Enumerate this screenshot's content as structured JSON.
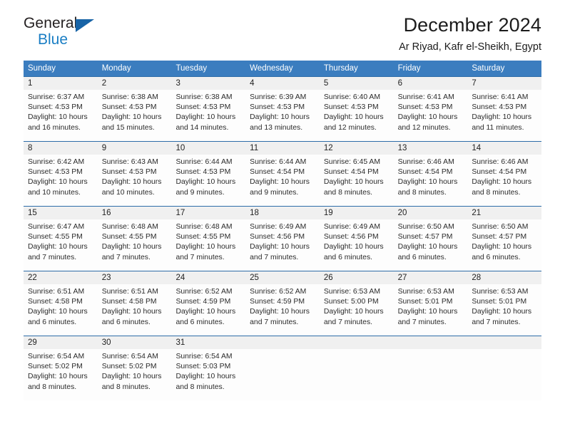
{
  "brand": {
    "name_part1": "General",
    "name_part2": "Blue"
  },
  "header": {
    "title": "December 2024",
    "subtitle": "Ar Riyad, Kafr el-Sheikh, Egypt"
  },
  "colors": {
    "header_blue": "#3b7dbf",
    "row_divider_blue": "#2e6da8",
    "date_band_gray": "#f0f0f0",
    "brand_blue": "#1a7ec4",
    "triangle_blue": "#1763a6",
    "text": "#222222"
  },
  "calendar": {
    "weekday_headers": [
      "Sunday",
      "Monday",
      "Tuesday",
      "Wednesday",
      "Thursday",
      "Friday",
      "Saturday"
    ],
    "weeks": [
      [
        {
          "day": "1",
          "sunrise": "Sunrise: 6:37 AM",
          "sunset": "Sunset: 4:53 PM",
          "daylight_line1": "Daylight: 10 hours",
          "daylight_line2": "and 16 minutes."
        },
        {
          "day": "2",
          "sunrise": "Sunrise: 6:38 AM",
          "sunset": "Sunset: 4:53 PM",
          "daylight_line1": "Daylight: 10 hours",
          "daylight_line2": "and 15 minutes."
        },
        {
          "day": "3",
          "sunrise": "Sunrise: 6:38 AM",
          "sunset": "Sunset: 4:53 PM",
          "daylight_line1": "Daylight: 10 hours",
          "daylight_line2": "and 14 minutes."
        },
        {
          "day": "4",
          "sunrise": "Sunrise: 6:39 AM",
          "sunset": "Sunset: 4:53 PM",
          "daylight_line1": "Daylight: 10 hours",
          "daylight_line2": "and 13 minutes."
        },
        {
          "day": "5",
          "sunrise": "Sunrise: 6:40 AM",
          "sunset": "Sunset: 4:53 PM",
          "daylight_line1": "Daylight: 10 hours",
          "daylight_line2": "and 12 minutes."
        },
        {
          "day": "6",
          "sunrise": "Sunrise: 6:41 AM",
          "sunset": "Sunset: 4:53 PM",
          "daylight_line1": "Daylight: 10 hours",
          "daylight_line2": "and 12 minutes."
        },
        {
          "day": "7",
          "sunrise": "Sunrise: 6:41 AM",
          "sunset": "Sunset: 4:53 PM",
          "daylight_line1": "Daylight: 10 hours",
          "daylight_line2": "and 11 minutes."
        }
      ],
      [
        {
          "day": "8",
          "sunrise": "Sunrise: 6:42 AM",
          "sunset": "Sunset: 4:53 PM",
          "daylight_line1": "Daylight: 10 hours",
          "daylight_line2": "and 10 minutes."
        },
        {
          "day": "9",
          "sunrise": "Sunrise: 6:43 AM",
          "sunset": "Sunset: 4:53 PM",
          "daylight_line1": "Daylight: 10 hours",
          "daylight_line2": "and 10 minutes."
        },
        {
          "day": "10",
          "sunrise": "Sunrise: 6:44 AM",
          "sunset": "Sunset: 4:53 PM",
          "daylight_line1": "Daylight: 10 hours",
          "daylight_line2": "and 9 minutes."
        },
        {
          "day": "11",
          "sunrise": "Sunrise: 6:44 AM",
          "sunset": "Sunset: 4:54 PM",
          "daylight_line1": "Daylight: 10 hours",
          "daylight_line2": "and 9 minutes."
        },
        {
          "day": "12",
          "sunrise": "Sunrise: 6:45 AM",
          "sunset": "Sunset: 4:54 PM",
          "daylight_line1": "Daylight: 10 hours",
          "daylight_line2": "and 8 minutes."
        },
        {
          "day": "13",
          "sunrise": "Sunrise: 6:46 AM",
          "sunset": "Sunset: 4:54 PM",
          "daylight_line1": "Daylight: 10 hours",
          "daylight_line2": "and 8 minutes."
        },
        {
          "day": "14",
          "sunrise": "Sunrise: 6:46 AM",
          "sunset": "Sunset: 4:54 PM",
          "daylight_line1": "Daylight: 10 hours",
          "daylight_line2": "and 8 minutes."
        }
      ],
      [
        {
          "day": "15",
          "sunrise": "Sunrise: 6:47 AM",
          "sunset": "Sunset: 4:55 PM",
          "daylight_line1": "Daylight: 10 hours",
          "daylight_line2": "and 7 minutes."
        },
        {
          "day": "16",
          "sunrise": "Sunrise: 6:48 AM",
          "sunset": "Sunset: 4:55 PM",
          "daylight_line1": "Daylight: 10 hours",
          "daylight_line2": "and 7 minutes."
        },
        {
          "day": "17",
          "sunrise": "Sunrise: 6:48 AM",
          "sunset": "Sunset: 4:55 PM",
          "daylight_line1": "Daylight: 10 hours",
          "daylight_line2": "and 7 minutes."
        },
        {
          "day": "18",
          "sunrise": "Sunrise: 6:49 AM",
          "sunset": "Sunset: 4:56 PM",
          "daylight_line1": "Daylight: 10 hours",
          "daylight_line2": "and 7 minutes."
        },
        {
          "day": "19",
          "sunrise": "Sunrise: 6:49 AM",
          "sunset": "Sunset: 4:56 PM",
          "daylight_line1": "Daylight: 10 hours",
          "daylight_line2": "and 6 minutes."
        },
        {
          "day": "20",
          "sunrise": "Sunrise: 6:50 AM",
          "sunset": "Sunset: 4:57 PM",
          "daylight_line1": "Daylight: 10 hours",
          "daylight_line2": "and 6 minutes."
        },
        {
          "day": "21",
          "sunrise": "Sunrise: 6:50 AM",
          "sunset": "Sunset: 4:57 PM",
          "daylight_line1": "Daylight: 10 hours",
          "daylight_line2": "and 6 minutes."
        }
      ],
      [
        {
          "day": "22",
          "sunrise": "Sunrise: 6:51 AM",
          "sunset": "Sunset: 4:58 PM",
          "daylight_line1": "Daylight: 10 hours",
          "daylight_line2": "and 6 minutes."
        },
        {
          "day": "23",
          "sunrise": "Sunrise: 6:51 AM",
          "sunset": "Sunset: 4:58 PM",
          "daylight_line1": "Daylight: 10 hours",
          "daylight_line2": "and 6 minutes."
        },
        {
          "day": "24",
          "sunrise": "Sunrise: 6:52 AM",
          "sunset": "Sunset: 4:59 PM",
          "daylight_line1": "Daylight: 10 hours",
          "daylight_line2": "and 6 minutes."
        },
        {
          "day": "25",
          "sunrise": "Sunrise: 6:52 AM",
          "sunset": "Sunset: 4:59 PM",
          "daylight_line1": "Daylight: 10 hours",
          "daylight_line2": "and 7 minutes."
        },
        {
          "day": "26",
          "sunrise": "Sunrise: 6:53 AM",
          "sunset": "Sunset: 5:00 PM",
          "daylight_line1": "Daylight: 10 hours",
          "daylight_line2": "and 7 minutes."
        },
        {
          "day": "27",
          "sunrise": "Sunrise: 6:53 AM",
          "sunset": "Sunset: 5:01 PM",
          "daylight_line1": "Daylight: 10 hours",
          "daylight_line2": "and 7 minutes."
        },
        {
          "day": "28",
          "sunrise": "Sunrise: 6:53 AM",
          "sunset": "Sunset: 5:01 PM",
          "daylight_line1": "Daylight: 10 hours",
          "daylight_line2": "and 7 minutes."
        }
      ],
      [
        {
          "day": "29",
          "sunrise": "Sunrise: 6:54 AM",
          "sunset": "Sunset: 5:02 PM",
          "daylight_line1": "Daylight: 10 hours",
          "daylight_line2": "and 8 minutes."
        },
        {
          "day": "30",
          "sunrise": "Sunrise: 6:54 AM",
          "sunset": "Sunset: 5:02 PM",
          "daylight_line1": "Daylight: 10 hours",
          "daylight_line2": "and 8 minutes."
        },
        {
          "day": "31",
          "sunrise": "Sunrise: 6:54 AM",
          "sunset": "Sunset: 5:03 PM",
          "daylight_line1": "Daylight: 10 hours",
          "daylight_line2": "and 8 minutes."
        },
        {
          "day": "",
          "sunrise": "",
          "sunset": "",
          "daylight_line1": "",
          "daylight_line2": ""
        },
        {
          "day": "",
          "sunrise": "",
          "sunset": "",
          "daylight_line1": "",
          "daylight_line2": ""
        },
        {
          "day": "",
          "sunrise": "",
          "sunset": "",
          "daylight_line1": "",
          "daylight_line2": ""
        },
        {
          "day": "",
          "sunrise": "",
          "sunset": "",
          "daylight_line1": "",
          "daylight_line2": ""
        }
      ]
    ]
  }
}
